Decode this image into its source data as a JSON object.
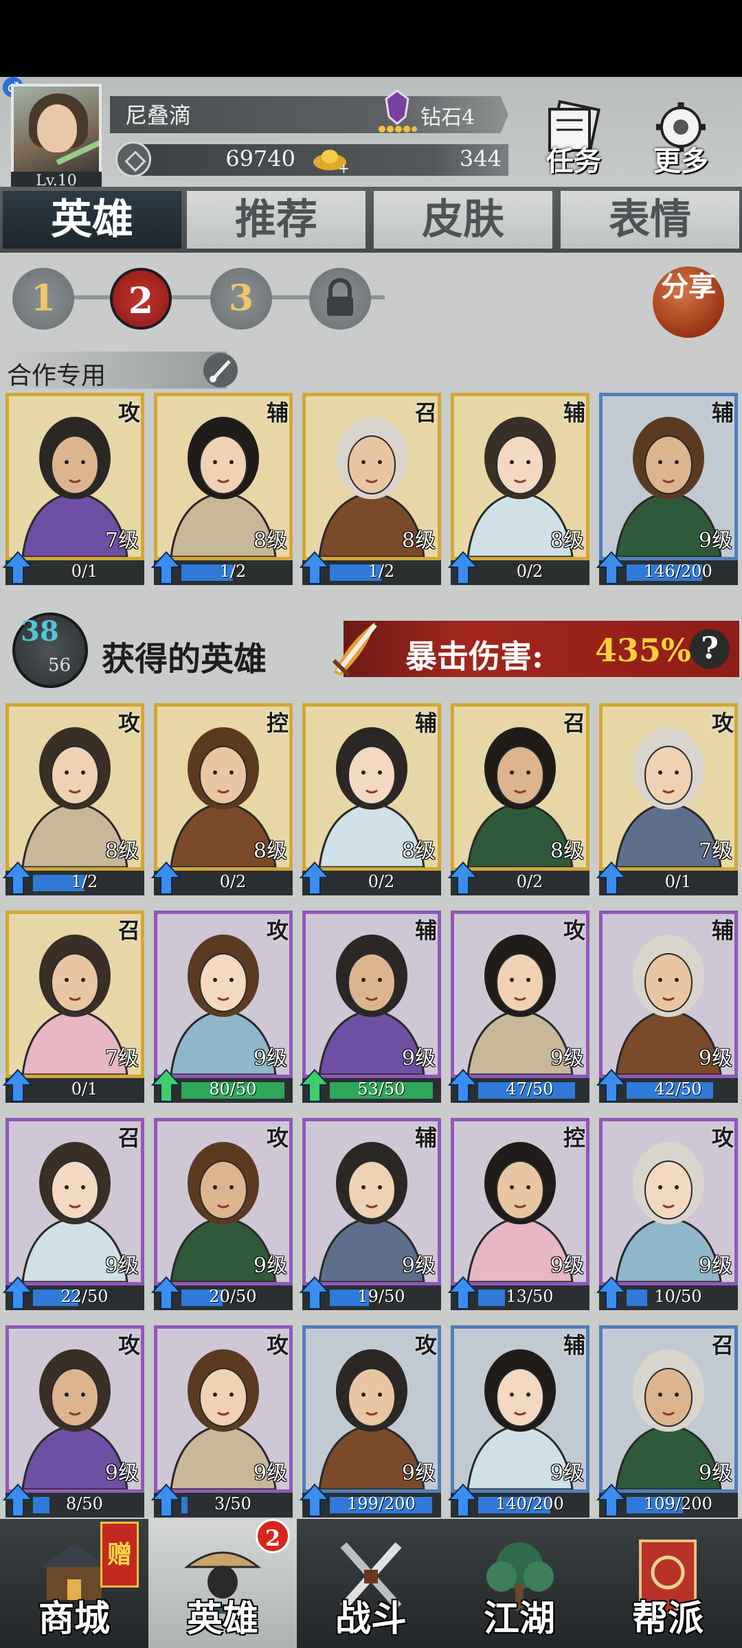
{
  "player": {
    "name": "尼叠滴",
    "level": "Lv.10",
    "rank": "钻石4",
    "coins": "69740",
    "gold": "344"
  },
  "top_buttons": {
    "tasks": "任务",
    "more": "更多"
  },
  "tabs": [
    "英雄",
    "推荐",
    "皮肤",
    "表情"
  ],
  "pages": [
    "1",
    "2",
    "3"
  ],
  "share_label": "分享",
  "coop_label": "合作专用",
  "coop_cards": [
    {
      "role": "攻",
      "level": "7级",
      "progress": "0/1",
      "fraction": 0.0,
      "rarity": "gold"
    },
    {
      "role": "辅",
      "level": "8级",
      "progress": "1/2",
      "fraction": 0.5,
      "rarity": "gold"
    },
    {
      "role": "召",
      "level": "8级",
      "progress": "1/2",
      "fraction": 0.5,
      "rarity": "gold"
    },
    {
      "role": "辅",
      "level": "8级",
      "progress": "0/2",
      "fraction": 0.0,
      "rarity": "gold"
    },
    {
      "role": "辅",
      "level": "9级",
      "progress": "146/200",
      "fraction": 0.73,
      "rarity": "blue"
    }
  ],
  "heroes_header": {
    "owned": "38",
    "total": "56",
    "title": "获得的英雄",
    "crit_label": "暴击伤害:",
    "crit_value": "435%",
    "help": "?"
  },
  "hero_cards": [
    {
      "role": "攻",
      "level": "8级",
      "progress": "1/2",
      "fraction": 0.5,
      "rarity": "gold"
    },
    {
      "role": "控",
      "level": "8级",
      "progress": "0/2",
      "fraction": 0.0,
      "rarity": "gold"
    },
    {
      "role": "辅",
      "level": "8级",
      "progress": "0/2",
      "fraction": 0.0,
      "rarity": "gold"
    },
    {
      "role": "召",
      "level": "8级",
      "progress": "0/2",
      "fraction": 0.0,
      "rarity": "gold"
    },
    {
      "role": "攻",
      "level": "7级",
      "progress": "0/1",
      "fraction": 0.0,
      "rarity": "gold"
    },
    {
      "role": "召",
      "level": "7级",
      "progress": "0/1",
      "fraction": 0.0,
      "rarity": "gold"
    },
    {
      "role": "攻",
      "level": "9级",
      "progress": "80/50",
      "fraction": 1.0,
      "rarity": "purple",
      "ready": true
    },
    {
      "role": "辅",
      "level": "9级",
      "progress": "53/50",
      "fraction": 1.0,
      "rarity": "purple",
      "ready": true
    },
    {
      "role": "攻",
      "level": "9级",
      "progress": "47/50",
      "fraction": 0.94,
      "rarity": "purple"
    },
    {
      "role": "辅",
      "level": "9级",
      "progress": "42/50",
      "fraction": 0.84,
      "rarity": "purple"
    },
    {
      "role": "召",
      "level": "9级",
      "progress": "22/50",
      "fraction": 0.44,
      "rarity": "purple"
    },
    {
      "role": "攻",
      "level": "9级",
      "progress": "20/50",
      "fraction": 0.4,
      "rarity": "purple"
    },
    {
      "role": "辅",
      "level": "9级",
      "progress": "19/50",
      "fraction": 0.38,
      "rarity": "purple"
    },
    {
      "role": "控",
      "level": "9级",
      "progress": "13/50",
      "fraction": 0.26,
      "rarity": "purple"
    },
    {
      "role": "攻",
      "level": "9级",
      "progress": "10/50",
      "fraction": 0.2,
      "rarity": "purple"
    },
    {
      "role": "攻",
      "level": "9级",
      "progress": "8/50",
      "fraction": 0.16,
      "rarity": "purple"
    },
    {
      "role": "攻",
      "level": "9级",
      "progress": "3/50",
      "fraction": 0.06,
      "rarity": "purple"
    },
    {
      "role": "攻",
      "level": "9级",
      "progress": "199/200",
      "fraction": 0.995,
      "rarity": "blue"
    },
    {
      "role": "辅",
      "level": "9级",
      "progress": "140/200",
      "fraction": 0.7,
      "rarity": "blue"
    },
    {
      "role": "召",
      "level": "9级",
      "progress": "109/200",
      "fraction": 0.545,
      "rarity": "blue"
    }
  ],
  "bottom_nav": [
    {
      "label": "商城",
      "icon": "shop-icon"
    },
    {
      "label": "英雄",
      "icon": "hero-icon",
      "badge": "2"
    },
    {
      "label": "战斗",
      "icon": "battle-icon"
    },
    {
      "label": "江湖",
      "icon": "jianghu-icon"
    },
    {
      "label": "帮派",
      "icon": "guild-icon"
    }
  ],
  "gift_label": "赠",
  "colors": {
    "gold_frame": "#d2a737",
    "purple_frame": "#9158b8",
    "blue_frame": "#4f7fb9",
    "progress_blue": "#2f7ad8",
    "progress_green": "#2fa65a",
    "accent_red": "#a1261d",
    "crit_yellow": "#ffd23a"
  }
}
